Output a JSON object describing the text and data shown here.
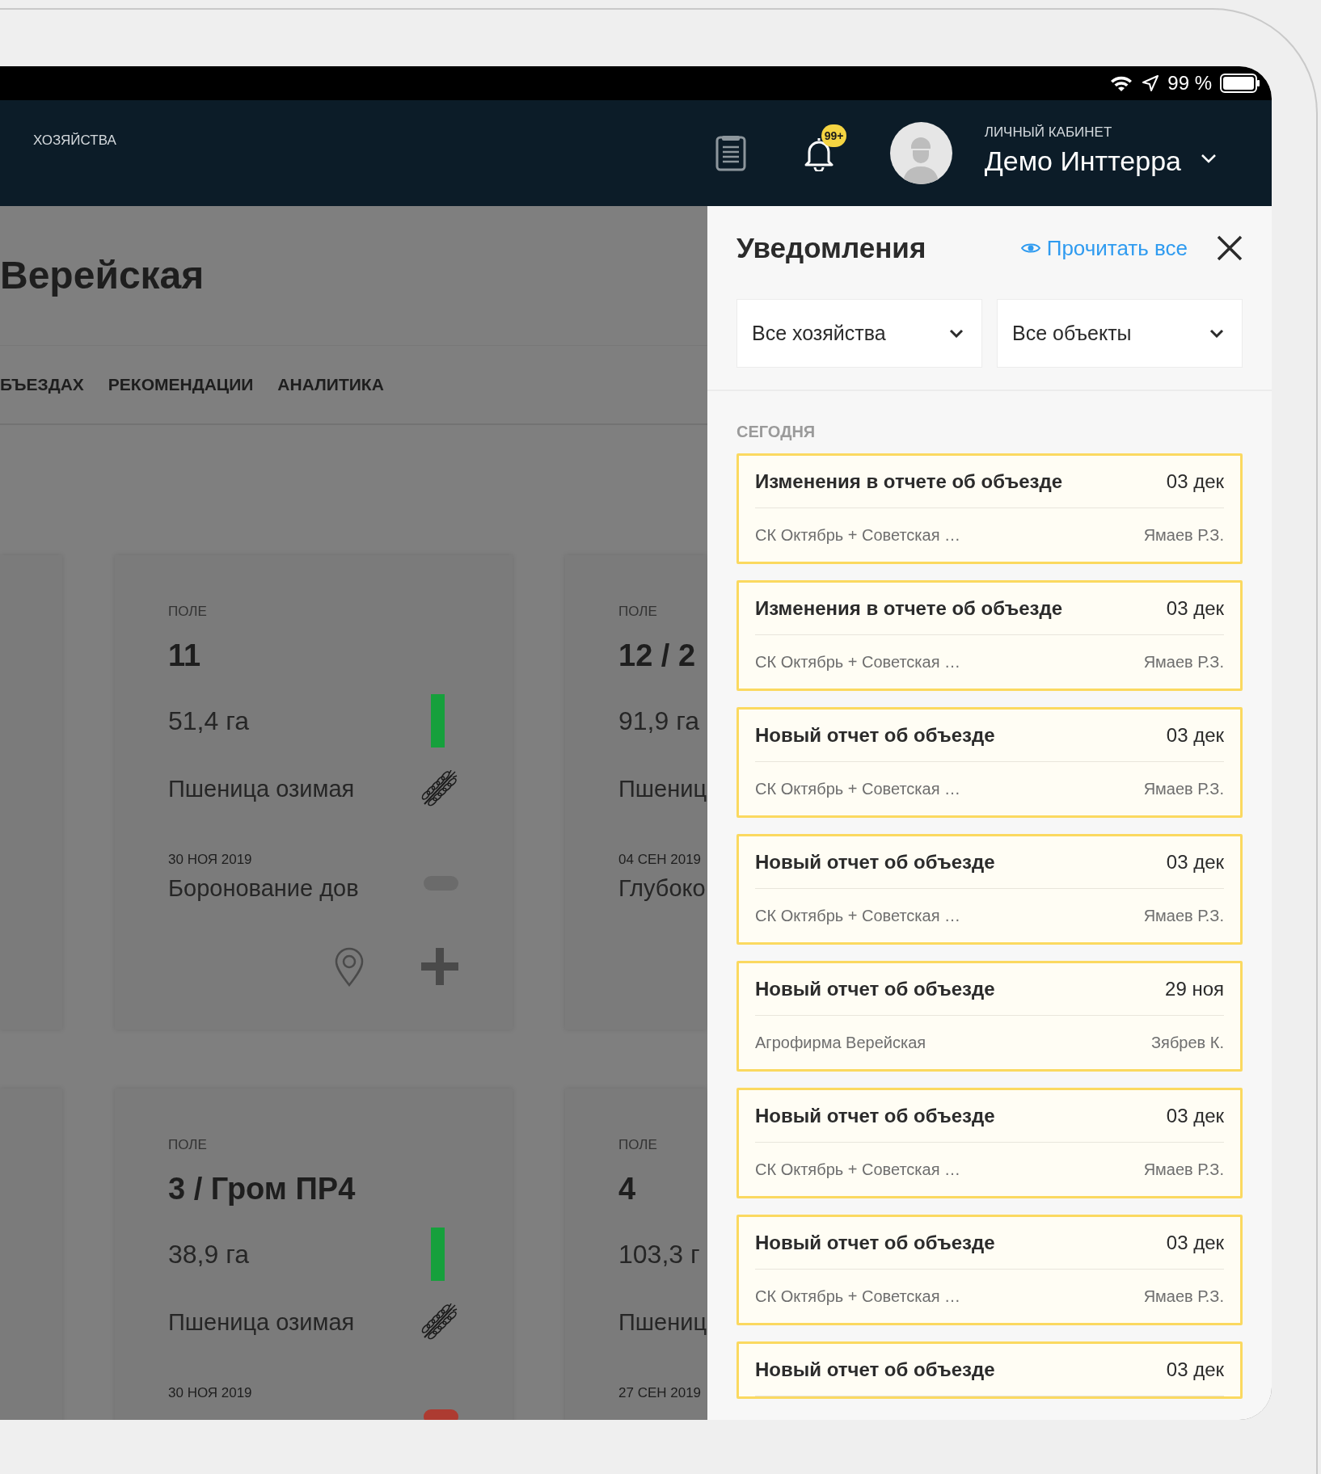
{
  "status_bar": {
    "battery": "99 %"
  },
  "header": {
    "nav_label": "ХОЗЯЙСТВА",
    "badge": "99+",
    "account_label": "ЛИЧНЫЙ КАБИНЕТ",
    "user_name": "Демо Инттерра"
  },
  "page": {
    "title": "Верейская",
    "tabs": [
      "БЪЕЗДАХ",
      "РЕКОМЕНДАЦИИ",
      "АНАЛИТИКА"
    ]
  },
  "field_rows": [
    [
      {
        "kind": "full",
        "label": "ПОЛЕ",
        "name": "11",
        "area": "51,4 га",
        "crop": "Пшеница озимая",
        "date": "30 НОЯ 2019",
        "operation": "Боронование дов",
        "status": {
          "color": "#16a03c"
        },
        "operation_status": {
          "color": "#6b6b6b"
        }
      },
      {
        "kind": "cut",
        "label": "ПОЛЕ",
        "name": "12 / 2",
        "area": "91,9 га",
        "crop": "Пшениц",
        "date": "04 СЕН 2019",
        "operation": "Глубоко"
      }
    ],
    [
      {
        "kind": "full",
        "label": "ПОЛЕ",
        "name": "3 / Гром ПР4",
        "area": "38,9 га",
        "crop": "Пшеница озимая",
        "date": "30 НОЯ 2019",
        "status": {
          "color": "#16a03c"
        },
        "operation_status": {
          "color": "#ad3b31"
        }
      },
      {
        "kind": "cut",
        "label": "ПОЛЕ",
        "name": "4",
        "area": "103,3 г",
        "crop": "Пшениц",
        "date": "27 СЕН 2019"
      }
    ]
  ],
  "notifications": {
    "title": "Уведомления",
    "read_all": "Прочитать все",
    "filters": [
      "Все хозяйства",
      "Все объекты"
    ],
    "section": "СЕГОДНЯ",
    "items": [
      {
        "title": "Изменения в отчете об объезде",
        "date": "03 дек",
        "farm": "СК Октябрь + Советская …",
        "author": "Ямаев Р.З."
      },
      {
        "title": "Изменения в отчете об объезде",
        "date": "03 дек",
        "farm": "СК Октябрь + Советская …",
        "author": "Ямаев Р.З."
      },
      {
        "title": "Новый отчет об объезде",
        "date": "03 дек",
        "farm": "СК Октябрь + Советская …",
        "author": "Ямаев Р.З."
      },
      {
        "title": "Новый отчет об объезде",
        "date": "03 дек",
        "farm": "СК Октябрь + Советская …",
        "author": "Ямаев Р.З."
      },
      {
        "title": "Новый отчет об объезде",
        "date": "29 ноя",
        "farm": "Агрофирма Верейская",
        "author": "Зябрев К."
      },
      {
        "title": "Новый отчет об объезде",
        "date": "03 дек",
        "farm": "СК Октябрь + Советская …",
        "author": "Ямаев Р.З."
      },
      {
        "title": "Новый отчет об объезде",
        "date": "03 дек",
        "farm": "СК Октябрь + Советская …",
        "author": "Ямаев Р.З."
      },
      {
        "title": "Новый отчет об объезде",
        "date": "03 дек"
      }
    ]
  }
}
